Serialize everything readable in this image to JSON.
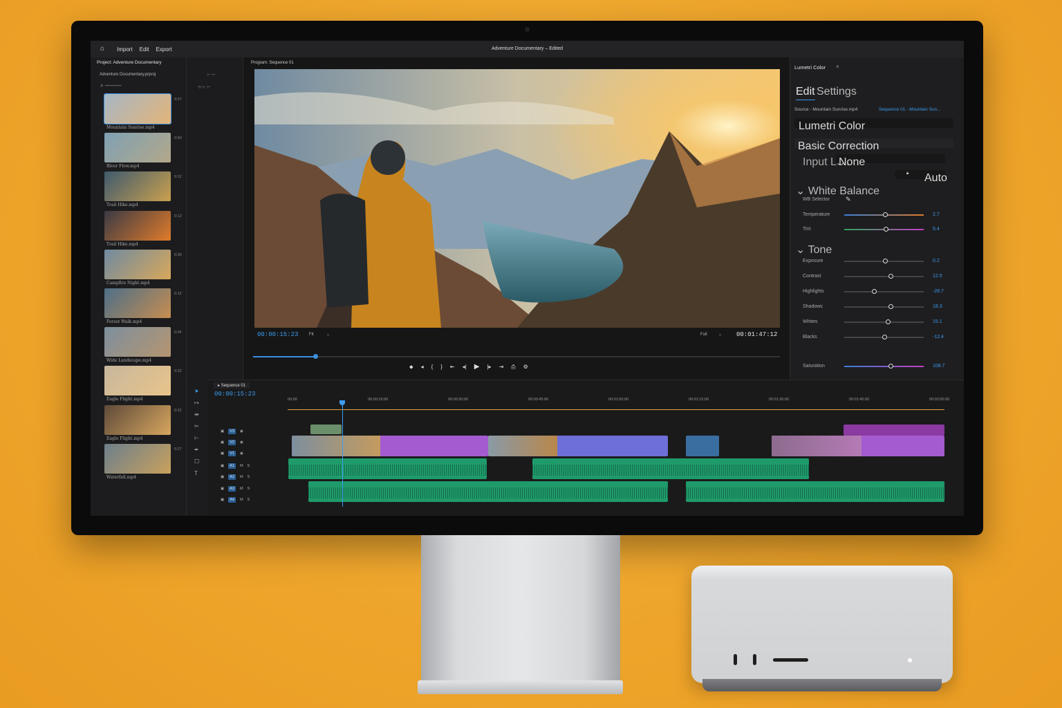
{
  "window": {
    "title": "Adventure Documentary – Edited"
  },
  "menu": [
    "Import",
    "Edit",
    "Export"
  ],
  "project": {
    "title": "Project: Adventure Documentary",
    "file": "Adventure Documentary.prproj",
    "clips": [
      {
        "name": "Mountain Sunrise.mp4",
        "time": "0:27"
      },
      {
        "name": "River Flow.mp4",
        "time": "0:50"
      },
      {
        "name": "Trail Hike.mp4",
        "time": "0:12"
      },
      {
        "name": "Trail Hike.mp4",
        "time": "0:12"
      },
      {
        "name": "Campfire Night.mp4",
        "time": "0:30"
      },
      {
        "name": "Forest Walk.mp4",
        "time": "0:12"
      },
      {
        "name": "Wide Landscape.mp4",
        "time": "0:24"
      },
      {
        "name": "Eagle Flight.mp4",
        "time": "0:22"
      },
      {
        "name": "Eagle Flight.mp4",
        "time": "0:22"
      },
      {
        "name": "Waterfall.mp4",
        "time": "0:27"
      }
    ]
  },
  "program": {
    "title": "Program: Sequence 01",
    "current_tc": "00:00:15:23",
    "fit": "Fit",
    "quality": "Full",
    "duration_tc": "00:01:47:12",
    "playhead_fraction": 0.095
  },
  "lumetri": {
    "title": "Lumetri Color",
    "tabs": [
      "Edit",
      "Settings"
    ],
    "source": "Source - Mountain Sunrise.mp4",
    "sequence": "Sequence 01 - Mountain Sun...",
    "effect": "Lumetri Color",
    "basic_correction": "Basic Correction",
    "input_lut_label": "Input LUT",
    "input_lut_value": "None",
    "auto": "Auto",
    "white_balance": "White Balance",
    "wb_selector": "WB Selector",
    "tone": "Tone",
    "sliders": [
      {
        "label": "Temperature",
        "value": "2.7",
        "pos": 0.51
      },
      {
        "label": "Tint",
        "value": "5.4",
        "pos": 0.52
      },
      {
        "label": "Exposure",
        "value": "0.2",
        "pos": 0.51
      },
      {
        "label": "Contrast",
        "value": "12.5",
        "pos": 0.58
      },
      {
        "label": "Highlights",
        "value": "-26.7",
        "pos": 0.37
      },
      {
        "label": "Shadows",
        "value": "18.3",
        "pos": 0.58
      },
      {
        "label": "Whites",
        "value": "15.1",
        "pos": 0.55
      },
      {
        "label": "Blacks",
        "value": "-12.4",
        "pos": 0.5
      }
    ],
    "saturation": {
      "label": "Saturation",
      "value": "108.7",
      "pos": 0.58
    }
  },
  "timeline": {
    "sequence": "Sequence 01",
    "current_tc": "00:00:15:23",
    "ruler": [
      "00:00",
      "00:00:15:00",
      "00:00:30:00",
      "00:00:45:00",
      "00:01:00:00",
      "00:01:15:00",
      "00:01:30:00",
      "00:01:45:00",
      "00:02:00:00"
    ],
    "video_tracks": [
      "V3",
      "V2",
      "V1"
    ],
    "audio_tracks": [
      "A1",
      "A2",
      "A3",
      "A4"
    ]
  },
  "colors": {
    "accent": "#3b9cf0",
    "video_clip": "#a45bd0",
    "audio_clip": "#1f9a6b",
    "background": "#f0a82a"
  }
}
